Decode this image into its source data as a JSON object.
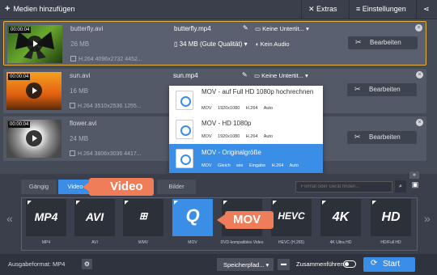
{
  "toolbar": {
    "add_label": "Medien hinzufügen",
    "extras": "Extras",
    "settings": "Einstellungen"
  },
  "files": [
    {
      "duration": "00:00:04",
      "name": "butterfly.avi",
      "size": "26 MB",
      "meta": "H.264 4096x2732 4452...",
      "out_name": "butterfly.mp4",
      "out_size": "34 MB (Gute Qualität)",
      "subtitles": "Keine Untertit...",
      "audio": "Kein Audio",
      "edit": "Bearbeiten"
    },
    {
      "duration": "00:00:04",
      "name": "sun.avi",
      "size": "16 MB",
      "meta": "H.264 3510x2536 1255...",
      "out_name": "sun.mp4",
      "subtitles": "Keine Untertit...",
      "edit": "Bearbeiten"
    },
    {
      "duration": "00:00:04",
      "name": "flower.avi",
      "size": "24 MB",
      "meta": "H.264 3806x3036 4417...",
      "edit": "Bearbeiten"
    }
  ],
  "dropdown": [
    {
      "title": "MOV - auf Full HD 1080p hochrechnen",
      "specs": "MOV 1920x1080 H.264 Auto"
    },
    {
      "title": "MOV - HD 1080p",
      "specs": "MOV 1920x1080 H.264 Auto"
    },
    {
      "title": "MOV - Originalgröße",
      "specs": "MOV Gleich wie Eingabe H.264 Auto"
    }
  ],
  "tabs": {
    "popular": "Gängig",
    "video": "Video",
    "images": "Bilder"
  },
  "callouts": {
    "video": "Video",
    "mov": "MOV"
  },
  "search_placeholder": "Format oder Gerät finden...",
  "formats": [
    {
      "logo": "MP4",
      "label": "MP4"
    },
    {
      "logo": "AVI",
      "label": "AVI"
    },
    {
      "logo": "WMV",
      "label": "WMV"
    },
    {
      "logo": "MOV",
      "label": "MOV"
    },
    {
      "logo": "DVD",
      "label": "DVD-kompatibles Video"
    },
    {
      "logo": "HEVC",
      "label": "HEVC (H.265)"
    },
    {
      "logo": "4K",
      "label": "4K Ultra HD"
    },
    {
      "logo": "HD",
      "label": "HD/Full HD"
    }
  ],
  "footer": {
    "output_format": "Ausgabeformat: MP4",
    "save_path": "Speicherpfad...",
    "merge": "Zusammenführen",
    "start": "Start"
  },
  "colors": {
    "accent": "#3a8ee6",
    "callout": "#f07d5a",
    "selected_border": "#e8b23a"
  }
}
